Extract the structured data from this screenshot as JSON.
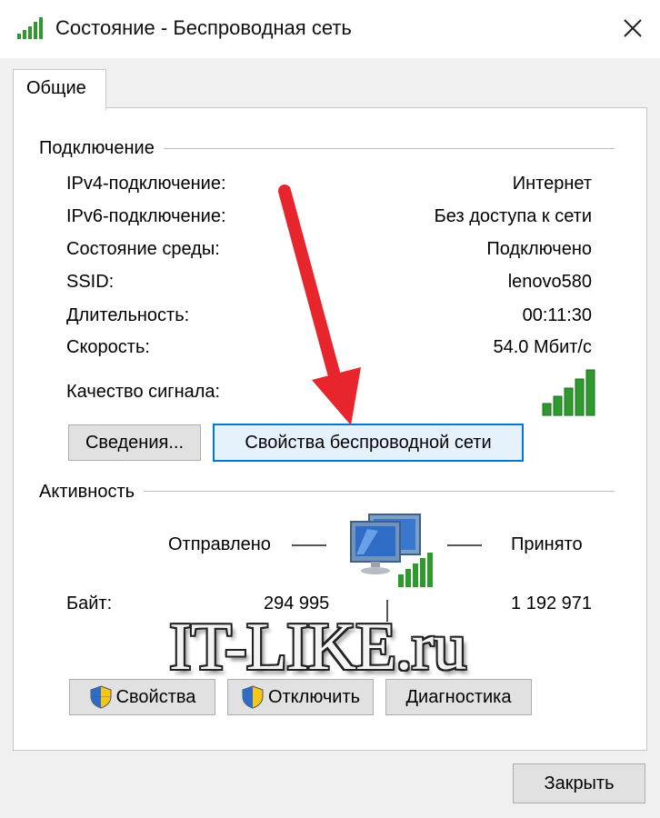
{
  "window": {
    "title": "Состояние - Беспроводная сеть",
    "icon": "wifi-signal-icon",
    "close_icon": "close-icon"
  },
  "tabs": [
    {
      "label": "Общие",
      "selected": true
    }
  ],
  "connection": {
    "group_label": "Подключение",
    "rows": [
      {
        "label": "IPv4-подключение:",
        "value": "Интернет"
      },
      {
        "label": "IPv6-подключение:",
        "value": "Без доступа к сети"
      },
      {
        "label": "Состояние среды:",
        "value": "Подключено"
      },
      {
        "label": "SSID:",
        "value": "lenovo580"
      },
      {
        "label": "Длительность:",
        "value": "00:11:30"
      },
      {
        "label": "Скорость:",
        "value": "54.0 Мбит/с"
      }
    ],
    "signal_label": "Качество сигнала:",
    "signal_bars": 5,
    "signal_bars_max": 5,
    "details_button": "Сведения...",
    "wireless_props_button": "Свойства беспроводной сети"
  },
  "activity": {
    "group_label": "Активность",
    "sent_label": "Отправлено",
    "received_label": "Принято",
    "bytes_label": "Байт:",
    "bytes_sent": "294 995",
    "bytes_received": "1 192 971",
    "icon": "network-computers-icon"
  },
  "buttons": {
    "properties": "Свойства",
    "disable": "Отключить",
    "diagnostics": "Диагностика",
    "close": "Закрыть"
  },
  "watermark": "IT-LIKE.ru",
  "colors": {
    "accent": "#0078d7",
    "signal_green": "#2e9a2e",
    "arrow_red": "#e8242c"
  }
}
